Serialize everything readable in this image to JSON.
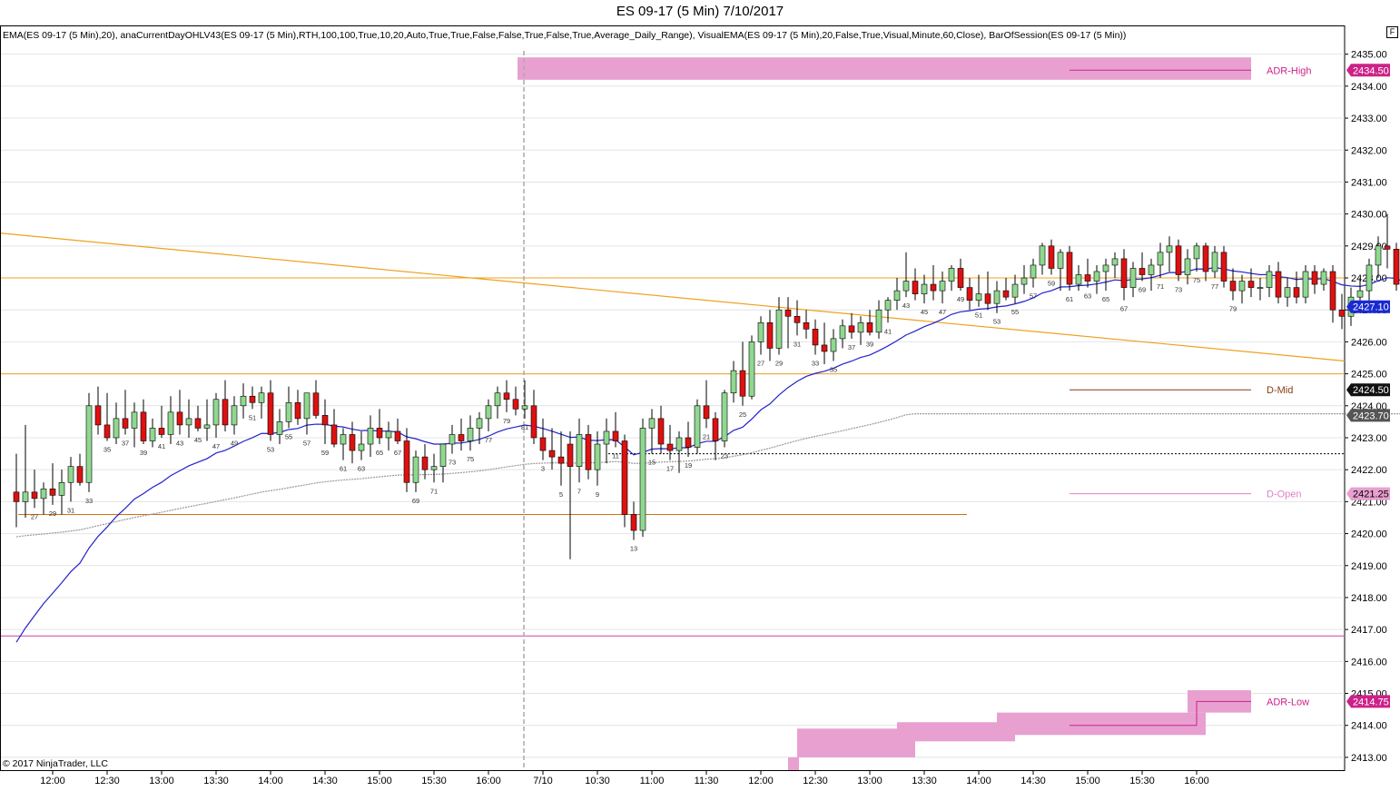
{
  "window": {
    "title": "ES 09-17 (5 Min)  7/10/2017",
    "indicators": "EMA(ES 09-17 (5 Min),20), anaCurrentDayOHLV43(ES 09-17 (5 Min),RTH,100,100,True,10,20,Auto,True,True,False,False,True,False,True,Average_Daily_Range), VisualEMA(ES 09-17 (5 Min),20,False,True,Visual,Minute,60,Close), BarOfSession(ES 09-17 (5 Min))",
    "copyright": "© 2017 NinjaTrader, LLC",
    "scale_button": "F"
  },
  "chart_data": {
    "type": "candlestick",
    "ylim": [
      2412.6,
      2435.9
    ],
    "y_ticks": [
      "2413.00",
      "2414.00",
      "2415.00",
      "2416.00",
      "2417.00",
      "2418.00",
      "2419.00",
      "2420.00",
      "2421.00",
      "2422.00",
      "2423.00",
      "2424.00",
      "2425.00",
      "2426.00",
      "2427.00",
      "2428.00",
      "2429.00",
      "2430.00",
      "2431.00",
      "2432.00",
      "2433.00",
      "2434.00",
      "2435.00"
    ],
    "x_ticks": [
      "12:00",
      "12:30",
      "13:00",
      "13:30",
      "14:00",
      "14:30",
      "15:00",
      "15:30",
      "16:00",
      "7/10",
      "10:30",
      "11:00",
      "11:30",
      "12:00",
      "12:30",
      "13:00",
      "13:30",
      "14:00",
      "14:30",
      "15:00",
      "15:30",
      "16:00"
    ],
    "colors": {
      "up": "#90d890",
      "down": "#dd1111",
      "ema": "#2222cc",
      "orange": "#f0a020",
      "magenta": "#cc44aa",
      "zone": "#e8a0d0",
      "gray": "#999999"
    },
    "bars": [
      [
        2421.3,
        2422.5,
        2420.2,
        2421.0
      ],
      [
        2421.0,
        2423.4,
        2420.5,
        2421.3
      ],
      [
        2421.3,
        2422.0,
        2420.8,
        2421.1
      ],
      [
        2421.1,
        2421.6,
        2420.6,
        2421.4
      ],
      [
        2421.4,
        2422.2,
        2420.9,
        2421.2
      ],
      [
        2421.2,
        2422.0,
        2420.6,
        2421.6
      ],
      [
        2421.6,
        2422.4,
        2421.0,
        2422.1
      ],
      [
        2422.1,
        2422.5,
        2421.5,
        2421.6
      ],
      [
        2421.6,
        2424.4,
        2421.3,
        2424.0
      ],
      [
        2424.0,
        2424.6,
        2423.1,
        2423.4
      ],
      [
        2423.4,
        2424.4,
        2422.9,
        2423.0
      ],
      [
        2423.0,
        2424.1,
        2422.8,
        2423.6
      ],
      [
        2423.6,
        2424.5,
        2423.1,
        2423.3
      ],
      [
        2423.3,
        2424.1,
        2422.7,
        2423.8
      ],
      [
        2423.8,
        2424.2,
        2422.8,
        2422.9
      ],
      [
        2422.9,
        2423.6,
        2422.7,
        2423.3
      ],
      [
        2423.3,
        2424.0,
        2423.0,
        2423.1
      ],
      [
        2423.1,
        2424.3,
        2422.8,
        2423.8
      ],
      [
        2423.8,
        2424.5,
        2423.1,
        2423.4
      ],
      [
        2423.4,
        2424.2,
        2423.0,
        2423.6
      ],
      [
        2423.6,
        2424.0,
        2423.2,
        2423.3
      ],
      [
        2423.3,
        2424.2,
        2422.9,
        2423.4
      ],
      [
        2423.4,
        2424.4,
        2423.0,
        2424.2
      ],
      [
        2424.2,
        2424.8,
        2423.2,
        2423.4
      ],
      [
        2423.4,
        2424.3,
        2423.1,
        2424.0
      ],
      [
        2424.0,
        2424.7,
        2423.6,
        2424.3
      ],
      [
        2424.3,
        2424.6,
        2423.9,
        2424.1
      ],
      [
        2424.1,
        2424.6,
        2423.6,
        2424.4
      ],
      [
        2424.4,
        2424.8,
        2422.9,
        2423.1
      ],
      [
        2423.1,
        2423.9,
        2422.8,
        2423.5
      ],
      [
        2423.5,
        2424.6,
        2423.3,
        2424.1
      ],
      [
        2424.1,
        2424.5,
        2423.4,
        2423.6
      ],
      [
        2423.6,
        2424.3,
        2423.1,
        2424.4
      ],
      [
        2424.4,
        2424.8,
        2423.6,
        2423.7
      ],
      [
        2423.7,
        2424.2,
        2422.8,
        2423.4
      ],
      [
        2423.4,
        2423.9,
        2422.7,
        2422.8
      ],
      [
        2422.8,
        2423.3,
        2422.3,
        2423.1
      ],
      [
        2423.1,
        2423.5,
        2422.2,
        2422.6
      ],
      [
        2422.6,
        2423.2,
        2422.3,
        2422.8
      ],
      [
        2422.8,
        2423.7,
        2422.4,
        2423.3
      ],
      [
        2423.3,
        2423.9,
        2422.8,
        2423.0
      ],
      [
        2423.0,
        2423.5,
        2422.6,
        2423.2
      ],
      [
        2423.2,
        2423.6,
        2422.8,
        2422.9
      ],
      [
        2422.9,
        2423.3,
        2421.3,
        2421.6
      ],
      [
        2421.6,
        2422.6,
        2421.3,
        2422.4
      ],
      [
        2422.4,
        2422.8,
        2421.7,
        2422.0
      ],
      [
        2422.0,
        2422.5,
        2421.6,
        2422.1
      ],
      [
        2422.1,
        2422.8,
        2421.6,
        2422.8
      ],
      [
        2422.8,
        2423.4,
        2422.5,
        2423.1
      ],
      [
        2423.1,
        2423.6,
        2422.6,
        2422.9
      ],
      [
        2422.9,
        2423.7,
        2422.6,
        2423.3
      ],
      [
        2423.3,
        2423.8,
        2422.8,
        2423.6
      ],
      [
        2423.6,
        2424.2,
        2423.2,
        2424.0
      ],
      [
        2424.0,
        2424.6,
        2423.6,
        2424.4
      ],
      [
        2424.4,
        2424.8,
        2423.8,
        2424.2
      ],
      [
        2424.2,
        2424.6,
        2423.7,
        2423.9
      ],
      [
        2423.9,
        2424.8,
        2423.6,
        2424.0
      ],
      [
        2424.0,
        2424.5,
        2422.8,
        2423.0
      ],
      [
        2423.0,
        2423.6,
        2422.3,
        2422.6
      ],
      [
        2422.6,
        2423.3,
        2422.0,
        2422.4
      ],
      [
        2422.4,
        2423.2,
        2421.5,
        2422.2
      ],
      [
        2422.8,
        2423.2,
        2419.2,
        2422.1
      ],
      [
        2422.1,
        2423.6,
        2421.6,
        2423.1
      ],
      [
        2423.1,
        2423.4,
        2421.7,
        2422.0
      ],
      [
        2422.0,
        2423.2,
        2421.5,
        2422.8
      ],
      [
        2422.8,
        2423.6,
        2422.2,
        2423.2
      ],
      [
        2423.2,
        2423.8,
        2422.7,
        2422.9
      ],
      [
        2422.9,
        2423.1,
        2420.2,
        2420.6
      ],
      [
        2420.6,
        2421.0,
        2419.8,
        2420.1
      ],
      [
        2420.1,
        2423.6,
        2419.9,
        2423.3
      ],
      [
        2423.3,
        2423.9,
        2422.5,
        2423.6
      ],
      [
        2423.6,
        2424.0,
        2422.5,
        2422.8
      ],
      [
        2422.8,
        2423.4,
        2422.3,
        2422.6
      ],
      [
        2422.6,
        2423.2,
        2421.9,
        2423.0
      ],
      [
        2423.0,
        2423.5,
        2422.4,
        2422.7
      ],
      [
        2422.7,
        2424.2,
        2422.5,
        2424.0
      ],
      [
        2424.0,
        2424.8,
        2423.3,
        2423.6
      ],
      [
        2423.6,
        2423.8,
        2422.3,
        2422.9
      ],
      [
        2422.9,
        2424.5,
        2422.7,
        2424.4
      ],
      [
        2424.4,
        2425.4,
        2424.1,
        2425.1
      ],
      [
        2425.1,
        2426.0,
        2424.0,
        2424.3
      ],
      [
        2424.3,
        2426.2,
        2424.2,
        2426.0
      ],
      [
        2426.0,
        2426.8,
        2425.6,
        2426.6
      ],
      [
        2426.6,
        2427.0,
        2425.4,
        2425.8
      ],
      [
        2425.8,
        2427.4,
        2425.6,
        2427.0
      ],
      [
        2427.0,
        2427.4,
        2425.8,
        2426.8
      ],
      [
        2426.8,
        2427.3,
        2426.2,
        2426.6
      ],
      [
        2426.6,
        2427.0,
        2426.1,
        2426.4
      ],
      [
        2426.4,
        2426.7,
        2425.6,
        2425.9
      ],
      [
        2425.9,
        2426.6,
        2425.3,
        2425.7
      ],
      [
        2425.7,
        2426.4,
        2425.4,
        2426.1
      ],
      [
        2426.1,
        2426.7,
        2425.8,
        2426.5
      ],
      [
        2426.5,
        2426.9,
        2426.1,
        2426.3
      ],
      [
        2426.3,
        2426.8,
        2425.9,
        2426.6
      ],
      [
        2426.6,
        2427.0,
        2426.2,
        2426.3
      ],
      [
        2426.3,
        2427.3,
        2426.1,
        2427.0
      ],
      [
        2427.0,
        2427.4,
        2426.6,
        2427.3
      ],
      [
        2427.3,
        2428.0,
        2427.0,
        2427.6
      ],
      [
        2427.6,
        2428.8,
        2427.4,
        2427.9
      ],
      [
        2427.9,
        2428.3,
        2427.3,
        2427.5
      ],
      [
        2427.5,
        2428.1,
        2427.2,
        2427.8
      ],
      [
        2427.8,
        2428.4,
        2427.3,
        2427.6
      ],
      [
        2427.6,
        2428.2,
        2427.2,
        2427.9
      ],
      [
        2427.9,
        2428.4,
        2427.6,
        2428.3
      ],
      [
        2428.3,
        2428.6,
        2427.6,
        2427.7
      ],
      [
        2427.7,
        2428.0,
        2427.0,
        2427.3
      ],
      [
        2427.3,
        2428.1,
        2427.1,
        2427.5
      ],
      [
        2427.5,
        2428.2,
        2427.0,
        2427.2
      ],
      [
        2427.2,
        2427.9,
        2426.9,
        2427.6
      ],
      [
        2427.6,
        2428.0,
        2427.3,
        2427.4
      ],
      [
        2427.4,
        2428.1,
        2427.2,
        2427.8
      ],
      [
        2427.8,
        2428.4,
        2427.5,
        2428.0
      ],
      [
        2428.0,
        2428.6,
        2427.7,
        2428.4
      ],
      [
        2428.4,
        2429.1,
        2428.1,
        2429.0
      ],
      [
        2429.0,
        2429.2,
        2428.1,
        2428.3
      ],
      [
        2428.3,
        2428.9,
        2427.6,
        2428.8
      ],
      [
        2428.8,
        2429.0,
        2427.6,
        2427.8
      ],
      [
        2427.8,
        2428.4,
        2427.6,
        2428.1
      ],
      [
        2428.1,
        2428.6,
        2427.7,
        2427.9
      ],
      [
        2427.9,
        2428.4,
        2427.5,
        2428.2
      ],
      [
        2428.2,
        2428.6,
        2427.6,
        2428.4
      ],
      [
        2428.4,
        2428.8,
        2428.0,
        2428.6
      ],
      [
        2428.6,
        2428.9,
        2427.3,
        2427.7
      ],
      [
        2427.7,
        2428.5,
        2427.4,
        2428.3
      ],
      [
        2428.3,
        2428.8,
        2427.9,
        2428.1
      ],
      [
        2428.1,
        2428.6,
        2427.6,
        2428.4
      ],
      [
        2428.4,
        2429.1,
        2428.0,
        2428.8
      ],
      [
        2428.8,
        2429.3,
        2428.2,
        2429.0
      ],
      [
        2429.0,
        2429.2,
        2427.9,
        2428.1
      ],
      [
        2428.1,
        2428.9,
        2427.8,
        2428.6
      ],
      [
        2428.6,
        2429.1,
        2428.2,
        2429.0
      ],
      [
        2429.0,
        2429.1,
        2427.9,
        2428.2
      ],
      [
        2428.2,
        2429.0,
        2428.0,
        2428.8
      ],
      [
        2428.8,
        2429.0,
        2427.7,
        2427.9
      ],
      [
        2427.9,
        2428.3,
        2427.3,
        2427.6
      ],
      [
        2427.6,
        2428.1,
        2427.2,
        2427.9
      ],
      [
        2427.9,
        2428.3,
        2427.4,
        2427.7
      ],
      [
        2427.7,
        2428.0,
        2427.3,
        2427.7
      ],
      [
        2427.7,
        2428.4,
        2427.4,
        2428.2
      ],
      [
        2428.2,
        2428.5,
        2427.2,
        2427.4
      ],
      [
        2427.4,
        2428.0,
        2427.1,
        2427.7
      ],
      [
        2427.7,
        2428.2,
        2427.2,
        2427.4
      ],
      [
        2427.4,
        2428.4,
        2427.2,
        2428.2
      ],
      [
        2428.2,
        2428.4,
        2427.5,
        2427.8
      ],
      [
        2427.8,
        2428.3,
        2427.6,
        2428.2
      ],
      [
        2428.2,
        2428.4,
        2426.6,
        2427.0
      ],
      [
        2427.0,
        2427.5,
        2426.4,
        2426.8
      ],
      [
        2426.8,
        2427.7,
        2426.5,
        2427.4
      ],
      [
        2427.4,
        2428.0,
        2427.0,
        2427.6
      ],
      [
        2427.6,
        2428.6,
        2427.2,
        2428.4
      ],
      [
        2428.4,
        2429.3,
        2428.0,
        2429.0
      ],
      [
        2429.0,
        2430.0,
        2428.3,
        2428.9
      ],
      [
        2428.9,
        2429.1,
        2427.6,
        2427.8
      ],
      [
        2427.8,
        2428.0,
        2426.2,
        2426.5
      ],
      [
        2426.5,
        2426.7,
        2425.3,
        2425.4
      ],
      [
        2425.4,
        2425.8,
        2424.9,
        2425.1
      ],
      [
        2425.1,
        2425.6,
        2424.5,
        2424.8
      ],
      [
        2424.8,
        2425.5,
        2424.1,
        2424.5
      ]
    ],
    "bar_labels": [
      {
        "i": 2,
        "text": "27"
      },
      {
        "i": 4,
        "text": "29"
      },
      {
        "i": 6,
        "text": "31"
      },
      {
        "i": 8,
        "text": "33"
      },
      {
        "i": 10,
        "text": "35"
      },
      {
        "i": 12,
        "text": "37"
      },
      {
        "i": 14,
        "text": "39"
      },
      {
        "i": 16,
        "text": "41"
      },
      {
        "i": 18,
        "text": "43"
      },
      {
        "i": 20,
        "text": "45"
      },
      {
        "i": 22,
        "text": "47"
      },
      {
        "i": 24,
        "text": "49"
      },
      {
        "i": 26,
        "text": "51"
      },
      {
        "i": 28,
        "text": "53"
      },
      {
        "i": 30,
        "text": "55"
      },
      {
        "i": 32,
        "text": "57"
      },
      {
        "i": 34,
        "text": "59"
      },
      {
        "i": 36,
        "text": "61"
      },
      {
        "i": 38,
        "text": "63"
      },
      {
        "i": 40,
        "text": "65"
      },
      {
        "i": 42,
        "text": "67"
      },
      {
        "i": 44,
        "text": "69"
      },
      {
        "i": 46,
        "text": "71"
      },
      {
        "i": 48,
        "text": "73"
      },
      {
        "i": 50,
        "text": "75"
      },
      {
        "i": 52,
        "text": "77"
      },
      {
        "i": 54,
        "text": "79"
      },
      {
        "i": 56,
        "text": "81"
      },
      {
        "i": 58,
        "text": "3"
      },
      {
        "i": 60,
        "text": "5"
      },
      {
        "i": 62,
        "text": "7"
      },
      {
        "i": 64,
        "text": "9"
      },
      {
        "i": 66,
        "text": "11"
      },
      {
        "i": 68,
        "text": "13"
      },
      {
        "i": 70,
        "text": "15"
      },
      {
        "i": 72,
        "text": "17"
      },
      {
        "i": 74,
        "text": "19"
      },
      {
        "i": 76,
        "text": "21"
      },
      {
        "i": 78,
        "text": "23"
      },
      {
        "i": 80,
        "text": "25"
      },
      {
        "i": 82,
        "text": "27"
      },
      {
        "i": 84,
        "text": "29"
      },
      {
        "i": 86,
        "text": "31"
      },
      {
        "i": 88,
        "text": "33"
      },
      {
        "i": 90,
        "text": "35"
      },
      {
        "i": 92,
        "text": "37"
      },
      {
        "i": 94,
        "text": "39"
      },
      {
        "i": 96,
        "text": "41"
      },
      {
        "i": 98,
        "text": "43"
      },
      {
        "i": 100,
        "text": "45"
      },
      {
        "i": 102,
        "text": "47"
      },
      {
        "i": 104,
        "text": "49"
      },
      {
        "i": 106,
        "text": "51"
      },
      {
        "i": 108,
        "text": "53"
      },
      {
        "i": 110,
        "text": "55"
      },
      {
        "i": 112,
        "text": "57"
      },
      {
        "i": 114,
        "text": "59"
      },
      {
        "i": 116,
        "text": "61"
      },
      {
        "i": 118,
        "text": "63"
      },
      {
        "i": 120,
        "text": "65"
      },
      {
        "i": 122,
        "text": "67"
      },
      {
        "i": 124,
        "text": "69"
      },
      {
        "i": 126,
        "text": "71"
      },
      {
        "i": 128,
        "text": "73"
      },
      {
        "i": 130,
        "text": "75"
      },
      {
        "i": 132,
        "text": "77"
      },
      {
        "i": 134,
        "text": "79"
      }
    ],
    "levels": {
      "adr_high": {
        "label": "ADR-High",
        "price": 2434.5,
        "display": "2434.50"
      },
      "d_mid": {
        "label": "D-Mid",
        "price": 2424.5,
        "display": "2424.50"
      },
      "d_open": {
        "label": "D-Open",
        "price": 2421.25,
        "display": "2421.25"
      },
      "adr_low": {
        "label": "ADR-Low",
        "price": 2414.75,
        "display": "2414.75"
      },
      "last_price": {
        "price": 2427.1,
        "display": "2427.10"
      },
      "vwap_marker": {
        "price": 2423.7,
        "display": "2423.70"
      }
    },
    "horizontal_lines": [
      {
        "name": "orange-level-2428",
        "price": 2428.0,
        "color": "orange"
      },
      {
        "name": "orange-level-2425",
        "price": 2425.0,
        "color": "orange"
      },
      {
        "name": "orange-level-2420-6",
        "price": 2420.6,
        "color": "orange"
      },
      {
        "name": "black-dotted-level",
        "price": 2422.5,
        "color": "black"
      },
      {
        "name": "magenta-level-2416-8",
        "price": 2416.8,
        "color": "magenta"
      }
    ],
    "trend_line": {
      "from_price": 2429.4,
      "to_price": 2425.4
    },
    "session_break_bar": 56,
    "ema_start": 2416.6
  }
}
